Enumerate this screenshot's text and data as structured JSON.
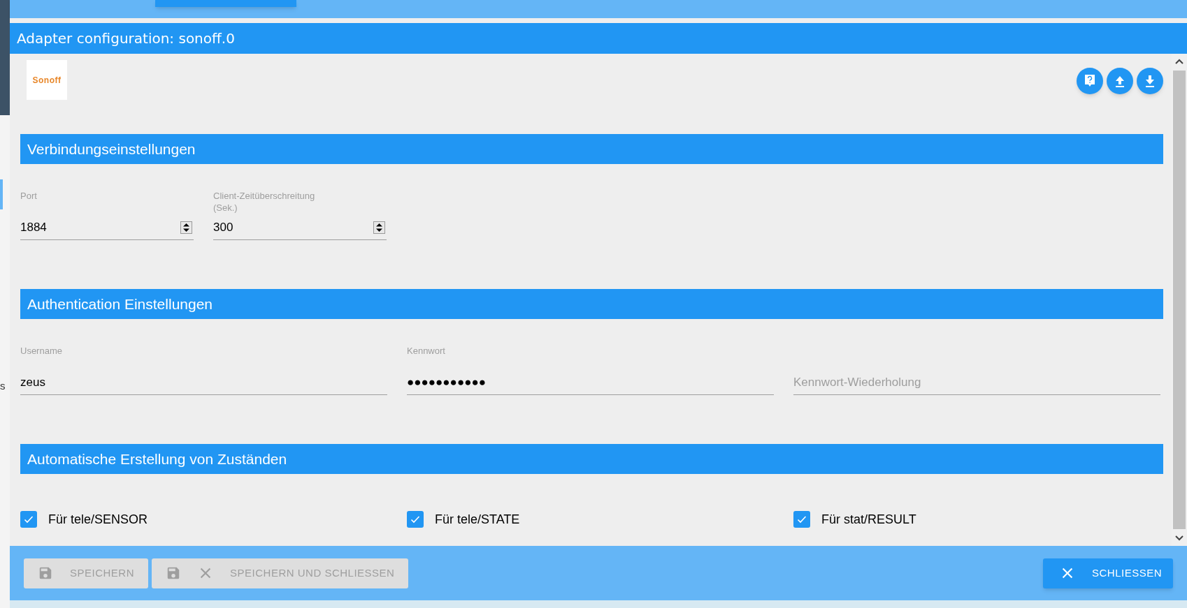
{
  "background": {
    "edge_letter": "s"
  },
  "dialog": {
    "title": "Adapter configuration: sonoff.0",
    "logo": "Sonoff"
  },
  "sections": [
    {
      "title": "Verbindungseinstellungen",
      "kind": "fields",
      "fields": [
        {
          "label": "Port",
          "value": "1884",
          "kind": "number"
        },
        {
          "label": "Client-Zeitüberschreitung (Sek.)",
          "value": "300",
          "kind": "number"
        }
      ]
    },
    {
      "title": "Authentication Einstellungen",
      "kind": "fields",
      "fields": [
        {
          "label": "Username",
          "value": "zeus",
          "kind": "text"
        },
        {
          "label": "Kennwort",
          "value": "●●●●●●●●●●●",
          "kind": "text"
        },
        {
          "placeholder": "Kennwort-Wiederholung",
          "kind": "text"
        }
      ]
    },
    {
      "title": "Automatische Erstellung von Zuständen",
      "kind": "checkboxes",
      "items": [
        {
          "label": "Für tele/SENSOR",
          "checked": true
        },
        {
          "label": "Für tele/STATE",
          "checked": true
        },
        {
          "label": "Für stat/RESULT",
          "checked": true
        }
      ]
    }
  ],
  "footer": {
    "buttons": [
      {
        "label": "SPEICHERN",
        "kind": "save",
        "disabled": true
      },
      {
        "label": "SPEICHERN UND SCHLIESSEN",
        "kind": "save_close",
        "disabled": true
      }
    ],
    "close": {
      "label": "SCHLIESSEN",
      "disabled": false
    }
  }
}
